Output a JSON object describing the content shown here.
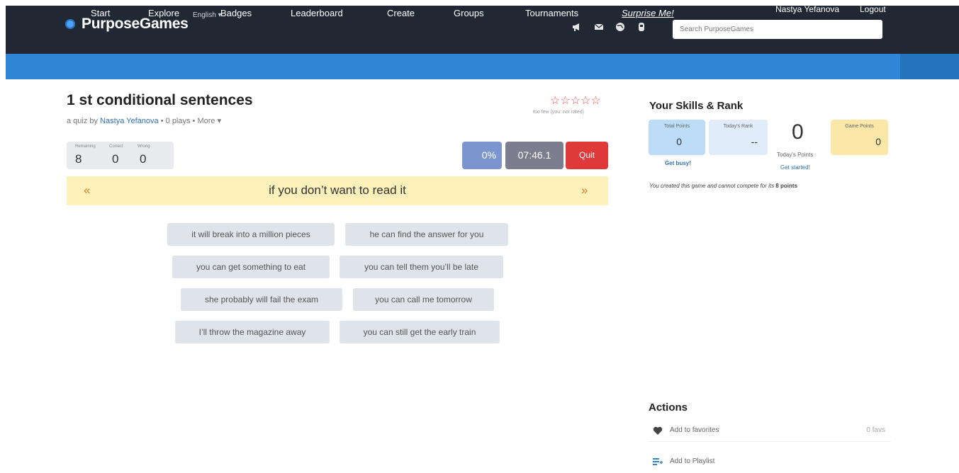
{
  "header": {
    "logo": "PurposeGames",
    "language": "English ▾",
    "icons": [
      {
        "name": "megaphone-icon",
        "glyph": "📢"
      },
      {
        "name": "mail-icon",
        "glyph": "✉"
      },
      {
        "name": "globe-icon",
        "glyph": "◉"
      },
      {
        "name": "profile-icon",
        "glyph": "☻"
      }
    ],
    "search_placeholder": "Search PurposeGames",
    "user_name": "Nastya Yefanova",
    "logout": "Logout"
  },
  "nav": {
    "items": [
      "Start",
      "Explore",
      "Badges",
      "Leaderboard",
      "Create",
      "Groups",
      "Tournaments",
      "Surprise Me!"
    ]
  },
  "quiz": {
    "title": "1 st conditional sentences",
    "by_prefix": "a quiz by",
    "author": "Nastya Yefanova",
    "plays": "• 0 plays •",
    "more": "More ▾",
    "stars": "☆☆☆☆☆",
    "rating_note": "too few (you: not rated)"
  },
  "counters": {
    "labels": [
      "Remaining",
      "Correct",
      "Wrong"
    ],
    "values": [
      "8",
      "0",
      "0"
    ]
  },
  "controls": {
    "percent": "0%",
    "timer": "07:46.1",
    "quit": "Quit"
  },
  "question": {
    "prev": "«",
    "text": "if you don’t want to read it",
    "next": "»"
  },
  "answers": [
    "it will break into a million pieces",
    "he can find the answer for you",
    "you can get something to eat",
    "you can tell them you’ll be late",
    "she probably will fail the exam",
    "you can call me tomorrow",
    "I’ll throw the magazine away",
    "you can still get the early train"
  ],
  "side": {
    "title": "Your Skills & Rank",
    "total_points_label": "Total Points",
    "total_points_value": "0",
    "todays_rank_label": "Today's Rank",
    "todays_rank_value": "--",
    "todays_points_value": "0",
    "todays_points_label": "Today's Points",
    "game_points_label": "Game Points",
    "game_points_value": "0",
    "get_busy": "Get busy!",
    "get_started": "Get started!",
    "notice_text": "You created this game and cannot compete for its",
    "notice_points": "8 points"
  },
  "actions": {
    "title": "Actions",
    "favorites_label": "Add to favorites",
    "favorites_count": "0 favs",
    "playlist_label": "Add to Playlist"
  },
  "colors": {
    "header_bg": "#1f2833",
    "nav_bg": "#2f86d6",
    "quit": "#e0393a",
    "question_bg": "#fcf1ba"
  }
}
